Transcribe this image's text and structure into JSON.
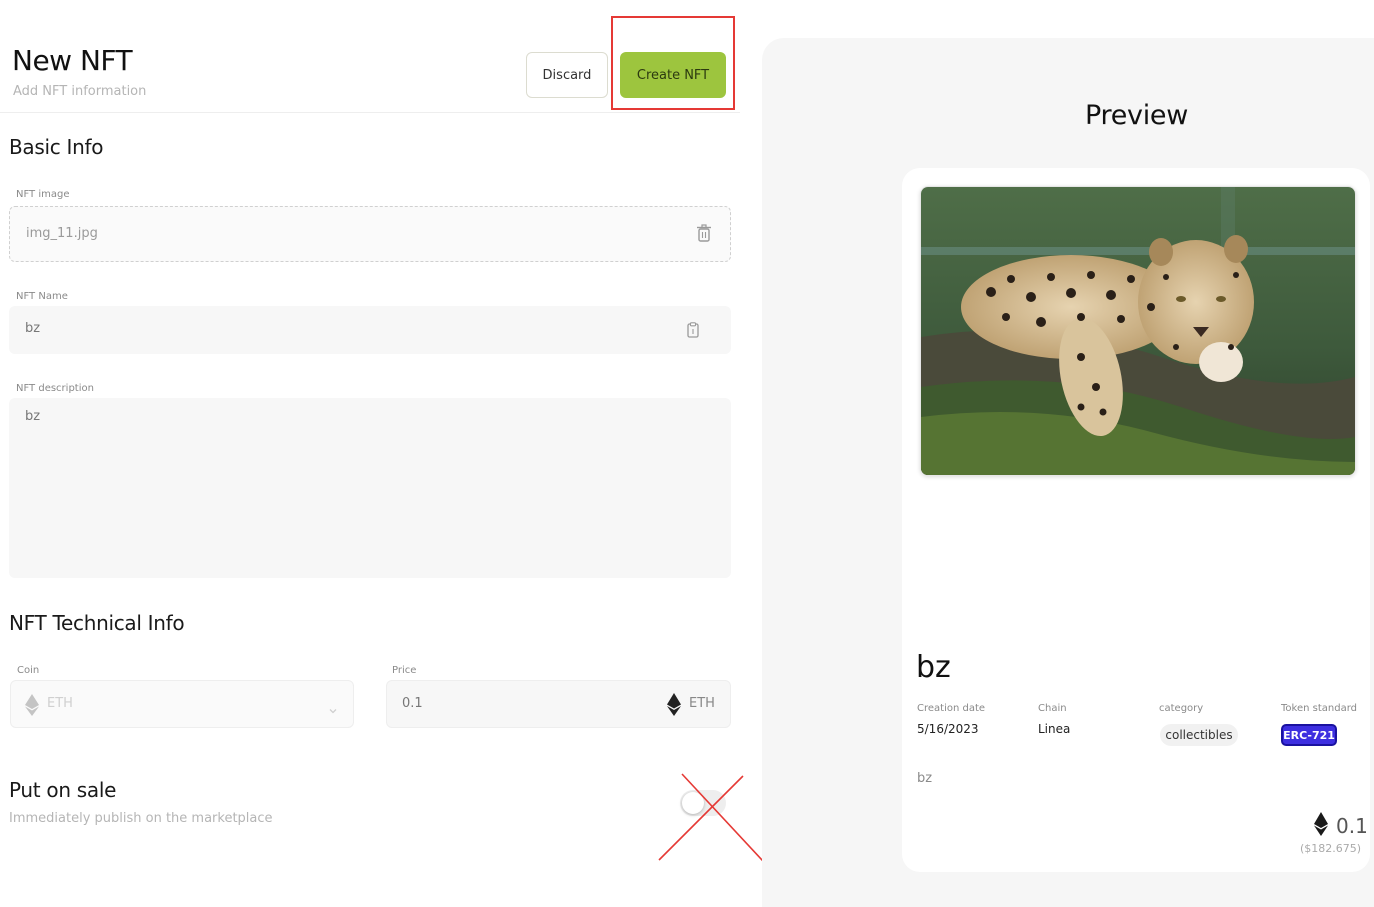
{
  "header": {
    "title": "New NFT",
    "subtitle": "Add NFT information",
    "discard_label": "Discard",
    "create_label": "Create NFT"
  },
  "basic_info": {
    "section_title": "Basic Info",
    "image_label": "NFT image",
    "image_value": "img_11.jpg",
    "name_label": "NFT Name",
    "name_value": "bz",
    "description_label": "NFT description",
    "description_value": "bz"
  },
  "technical_info": {
    "section_title": "NFT Technical Info",
    "coin_label": "Coin",
    "coin_value": "ETH",
    "price_label": "Price",
    "price_value": "0.1",
    "price_unit": "ETH"
  },
  "sale": {
    "title": "Put on sale",
    "description": "Immediately publish on the marketplace",
    "enabled": false
  },
  "preview": {
    "title": "Preview",
    "name": "bz",
    "creation_date_label": "Creation date",
    "creation_date_value": "5/16/2023",
    "chain_label": "Chain",
    "chain_value": "Linea",
    "category_label": "category",
    "category_value": "collectibles",
    "token_standard_label": "Token standard",
    "token_standard_value": "ERC-721",
    "description": "bz",
    "price": "0.1",
    "price_usd": "($182.675)"
  },
  "colors": {
    "accent": "#9dc53e",
    "highlight": "#e53935",
    "token_badge": "#3d2fe0"
  },
  "icons": [
    "trash-icon",
    "clipboard-icon",
    "ethereum-icon",
    "chevron-down-icon"
  ]
}
